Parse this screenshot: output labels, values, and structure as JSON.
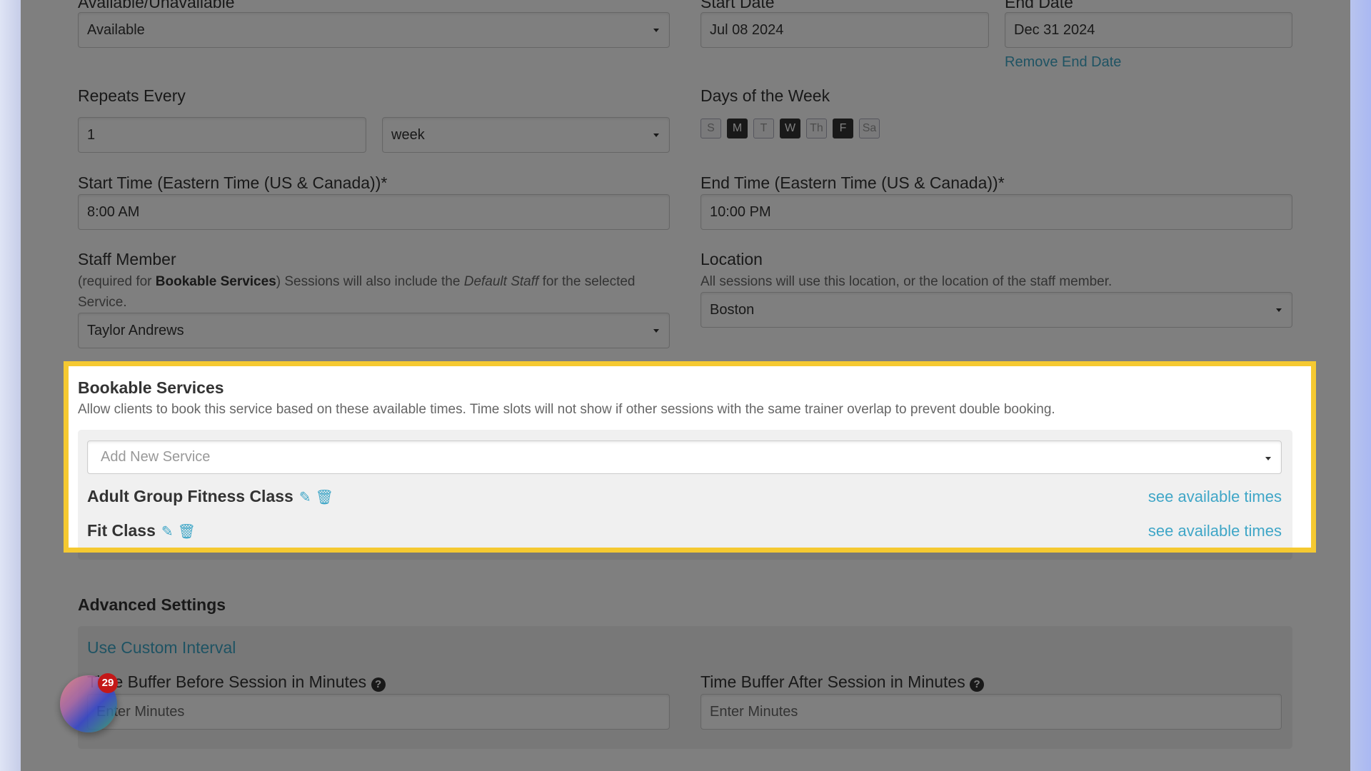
{
  "availability": {
    "label": "Available/Unavailable",
    "value": "Available"
  },
  "start_date": {
    "label": "Start Date",
    "value": "Jul 08 2024"
  },
  "end_date": {
    "label": "End Date",
    "value": "Dec 31 2024",
    "remove_link": "Remove End Date"
  },
  "repeats": {
    "label": "Repeats Every",
    "count": "1",
    "unit": "week"
  },
  "days": {
    "label": "Days of the Week",
    "items": [
      {
        "label": "S",
        "selected": false
      },
      {
        "label": "M",
        "selected": true
      },
      {
        "label": "T",
        "selected": false
      },
      {
        "label": "W",
        "selected": true
      },
      {
        "label": "Th",
        "selected": false
      },
      {
        "label": "F",
        "selected": true
      },
      {
        "label": "Sa",
        "selected": false
      }
    ]
  },
  "start_time": {
    "label": "Start Time (Eastern Time (US & Canada))*",
    "value": "8:00 AM"
  },
  "end_time": {
    "label": "End Time (Eastern Time (US & Canada))*",
    "value": "10:00 PM"
  },
  "staff": {
    "label": "Staff Member",
    "desc_pre": "(required for ",
    "desc_bold": "Bookable Services",
    "desc_mid": ") Sessions will also include the ",
    "desc_italic": "Default Staff",
    "desc_post": " for the selected Service.",
    "value": "Taylor Andrews"
  },
  "location": {
    "label": "Location",
    "desc": "All sessions will use this location, or the location of the staff member.",
    "value": "Boston"
  },
  "bookable": {
    "title": "Bookable Services",
    "desc": "Allow clients to book this service based on these available times. Time slots will not show if other sessions with the same trainer overlap to prevent double booking.",
    "placeholder": "Add New Service",
    "services": [
      {
        "name": "Adult Group Fitness Class",
        "link": "see available times"
      },
      {
        "name": "Fit Class",
        "link": "see available times"
      }
    ]
  },
  "advanced": {
    "title": "Advanced Settings",
    "custom_interval": "Use Custom Interval",
    "buffer_before": {
      "label": "Time Buffer Before Session in Minutes",
      "placeholder": "Enter Minutes"
    },
    "buffer_after": {
      "label": "Time Buffer After Session in Minutes",
      "placeholder": "Enter Minutes"
    }
  },
  "widget": {
    "badge": "29"
  },
  "colors": {
    "link": "#3fa6c7",
    "highlight": "#f5c931"
  }
}
